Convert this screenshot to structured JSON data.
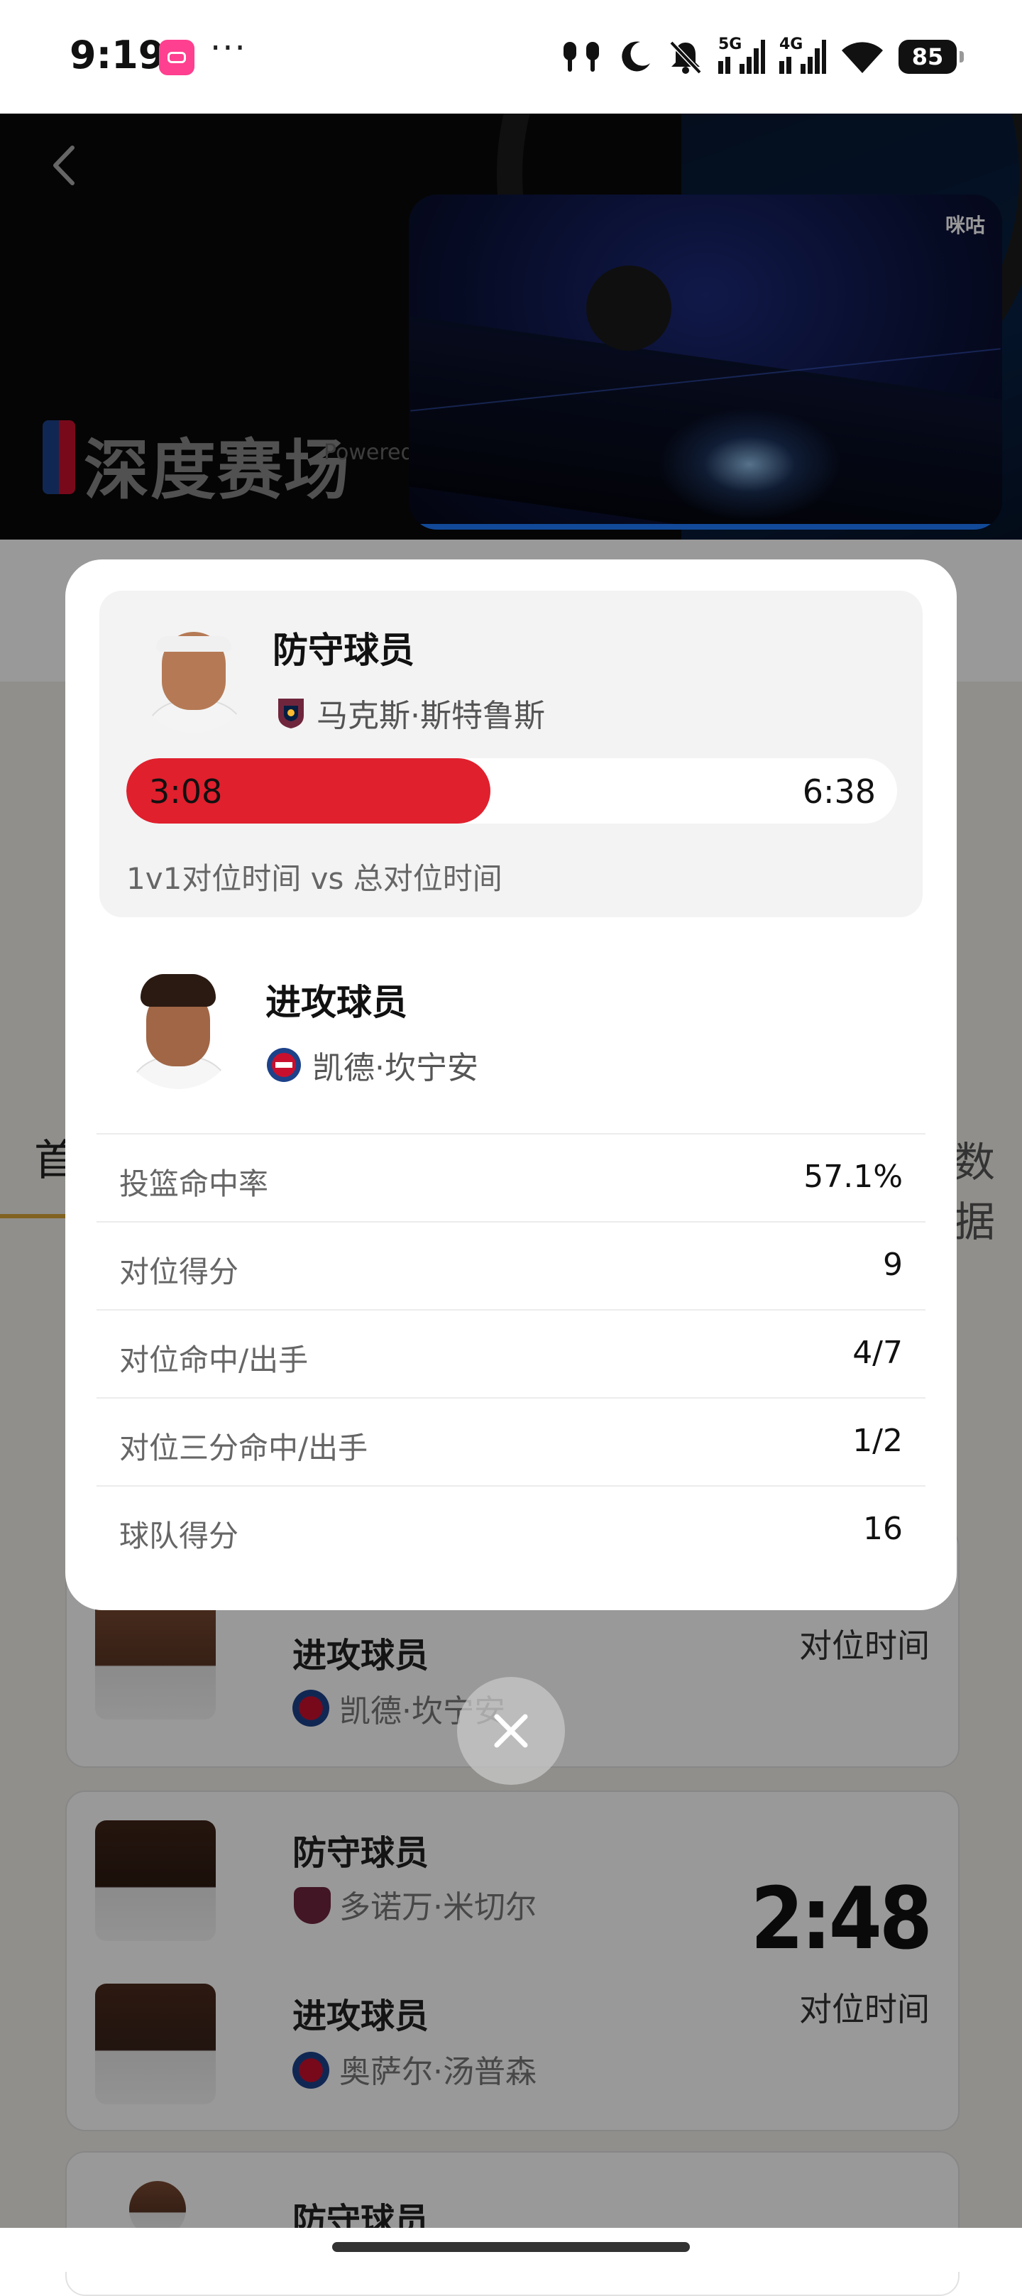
{
  "status_bar": {
    "time": "9:19",
    "more": "···",
    "network_1": "5G",
    "network_2": "4G",
    "battery": "85"
  },
  "hero": {
    "title": "深度赛场",
    "powered": "Powered"
  },
  "video": {
    "watermark": "咪咕"
  },
  "background": {
    "tab_left": "首",
    "tab_right": "数据",
    "cards": [
      {
        "role_top": "进攻球员",
        "name_top": "凯德·坎宁安",
        "time_label": "对位时间"
      },
      {
        "role_top": "防守球员",
        "name_top": "多诺万·米切尔",
        "role_bottom": "进攻球员",
        "name_bottom": "奥萨尔·汤普森",
        "time_value": "2:48",
        "time_label": "对位时间"
      },
      {
        "role_top": "防守球员"
      }
    ]
  },
  "modal": {
    "defender": {
      "role": "防守球员",
      "name": "马克斯·斯特鲁斯",
      "matchup_1v1": "3:08",
      "matchup_total": "6:38",
      "matchup_fraction": 0.472,
      "caption": "1v1对位时间 vs 总对位时间"
    },
    "attacker": {
      "role": "进攻球员",
      "name": "凯德·坎宁安"
    },
    "stats": [
      {
        "label": "投篮命中率",
        "value": "57.1%"
      },
      {
        "label": "对位得分",
        "value": "9"
      },
      {
        "label": "对位命中/出手",
        "value": "4/7"
      },
      {
        "label": "对位三分命中/出手",
        "value": "1/2"
      },
      {
        "label": "球队得分",
        "value": "16"
      }
    ]
  },
  "colors": {
    "bar_fill": "#e0202d",
    "accent_gold": "#d9a437",
    "pistons_blue": "#1d428a",
    "pistons_red": "#c8102e",
    "cavs_wine": "#6f263d"
  }
}
